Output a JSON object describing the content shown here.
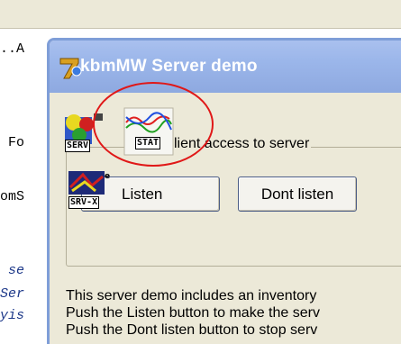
{
  "background_code": {
    "lines": [
      {
        "text": "..A",
        "italic": false
      },
      {
        "text": " Fo",
        "italic": false
      },
      {
        "text": "omS",
        "italic": false
      },
      {
        "text": " se",
        "italic": true
      },
      {
        "text": "Ser",
        "italic": true
      },
      {
        "text": "yis",
        "italic": true
      }
    ]
  },
  "window": {
    "title": "kbmMW Server demo",
    "group_caption": "client access to server",
    "group_caption_partial": "t",
    "buttons": {
      "listen": "Listen",
      "dont_listen": "Dont listen"
    },
    "description": [
      "This server demo includes an inventory",
      "Push the Listen button to make the serv",
      "Push the Dont listen button to stop serv"
    ]
  },
  "toolbar_icons": [
    {
      "label": "SERV",
      "icon": "server-icon"
    },
    {
      "label": "STAT",
      "icon": "statistics-icon"
    },
    {
      "label": "SRV-X",
      "icon": "server-x-icon"
    }
  ],
  "colors": {
    "title_bar": "#9bb6ea",
    "window_bg": "#ece9d8",
    "annotation": "#e01818"
  }
}
